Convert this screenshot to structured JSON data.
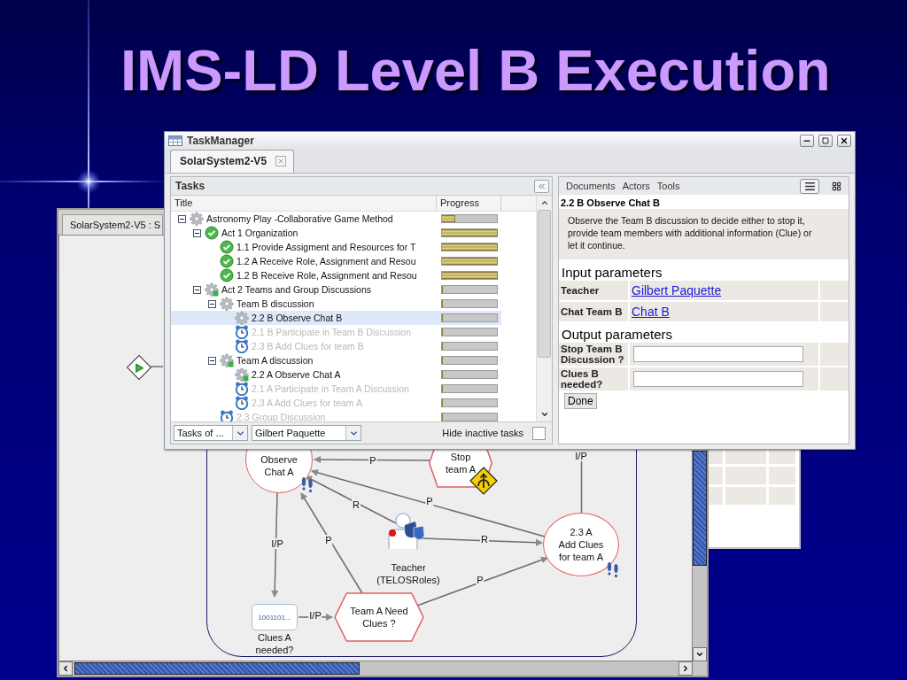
{
  "slide": {
    "title": "IMS-LD Level B Execution"
  },
  "editor_window": {
    "tab": "SolarSystem2-V5 : S",
    "nodes": [
      {
        "kind": "start"
      },
      {
        "kind": "activity",
        "label": "Observe\nChat A"
      },
      {
        "kind": "decision",
        "label": "Stop\nteam A"
      },
      {
        "kind": "activity",
        "label": "2.3 A\nAdd Clues\nfor team A"
      },
      {
        "kind": "role",
        "label": "Teacher\n(TELOSRoles)"
      },
      {
        "kind": "resource",
        "content": "1001101...",
        "label": "Clues A\nneeded?"
      },
      {
        "kind": "decision",
        "label": "Team A Need\nClues ?"
      }
    ],
    "edges": [
      {
        "kind": "line"
      },
      {
        "kind": "arrow",
        "label": "P"
      },
      {
        "kind": "arrow",
        "label": "P"
      },
      {
        "kind": "arrow",
        "label": "R"
      },
      {
        "kind": "arrow",
        "label": "R"
      },
      {
        "kind": "arrow",
        "label": "I/P"
      },
      {
        "kind": "arrow",
        "label": "P"
      },
      {
        "kind": "arrow",
        "label": "P"
      },
      {
        "kind": "arrow",
        "label": "I/P"
      },
      {
        "kind": "line",
        "label": "I/P"
      }
    ]
  },
  "task_window": {
    "title": "TaskManager",
    "tabs": [
      {
        "label": "SolarSystem2-V5",
        "selected": true
      }
    ],
    "tasks_panel": {
      "title": "Tasks",
      "columns": [
        "Title",
        "Progress"
      ],
      "tree": [
        {
          "label": "Astronomy Play -Collaborative Game Method",
          "kind": "running",
          "inactive": false,
          "selected": false,
          "expanded": true,
          "level": 0.24,
          "children": [
            {
              "label": "Act 1 Organization",
              "kind": "done",
              "inactive": false,
              "selected": false,
              "expanded": true,
              "level": 1,
              "children": [
                {
                  "label": "1.1 Provide Assigment and Resources for T",
                  "kind": "done",
                  "inactive": false,
                  "selected": false,
                  "level": 1
                },
                {
                  "label": "1.2 A Receive Role, Assignment and Resou",
                  "kind": "done",
                  "inactive": false,
                  "selected": false,
                  "level": 1
                },
                {
                  "label": "1.2 B Receive Role, Assignment and Resou",
                  "kind": "done",
                  "inactive": false,
                  "selected": false,
                  "level": 1
                }
              ]
            },
            {
              "label": "Act 2 Teams and Group Discussions",
              "kind": "started",
              "inactive": false,
              "selected": false,
              "expanded": true,
              "level": 0,
              "children": [
                {
                  "label": "Team B discussion",
                  "kind": "running",
                  "inactive": false,
                  "selected": false,
                  "expanded": true,
                  "level": 0,
                  "children": [
                    {
                      "label": "2.2 B Observe Chat B",
                      "kind": "running",
                      "inactive": false,
                      "selected": true,
                      "level": 0
                    },
                    {
                      "label": "2.1 B Participate in Team B Discussion",
                      "kind": "waiting",
                      "inactive": true,
                      "selected": false,
                      "level": 0
                    },
                    {
                      "label": "2.3 B Add Clues for team B",
                      "kind": "waiting",
                      "inactive": true,
                      "selected": false,
                      "level": 0
                    }
                  ]
                },
                {
                  "label": "Team A discussion",
                  "kind": "started",
                  "inactive": false,
                  "selected": false,
                  "expanded": true,
                  "level": 0,
                  "children": [
                    {
                      "label": "2.2 A Observe Chat A",
                      "kind": "started",
                      "inactive": false,
                      "selected": false,
                      "level": 0
                    },
                    {
                      "label": "2.1 A Participate in Team A Discussion",
                      "kind": "waiting",
                      "inactive": true,
                      "selected": false,
                      "level": 0
                    },
                    {
                      "label": "2.3 A Add Clues for team A",
                      "kind": "waiting",
                      "inactive": true,
                      "selected": false,
                      "level": 0
                    }
                  ]
                },
                {
                  "label": "2.3 Group Discussion",
                  "kind": "waiting",
                  "inactive": true,
                  "selected": false,
                  "level": 0
                }
              ]
            }
          ]
        }
      ],
      "filters": [
        {
          "value": "Tasks of ..."
        },
        {
          "value": "Gilbert Paquette"
        }
      ],
      "hide_inactive": {
        "label": "Hide inactive tasks",
        "checked": false
      }
    },
    "detail_panel": {
      "menu": [
        "Documents",
        "Actors",
        "Tools"
      ],
      "views": [
        {
          "kind": "list",
          "selected": true
        },
        {
          "kind": "grid",
          "selected": false
        }
      ],
      "task_title": "2.2 B Observe Chat B",
      "description": "Observe the Team B discussion to decide either to stop it, provide team members with additional information (Clue) or let it continue.",
      "input_heading": "Input parameters",
      "inputs": [
        {
          "name": "Teacher",
          "value": "Gilbert Paquette"
        },
        {
          "name": "Chat Team B",
          "value": "Chat B"
        }
      ],
      "output_heading": "Output parameters",
      "outputs": [
        {
          "name": "Stop Team B Discussion ?"
        },
        {
          "name": "Clues B needed?"
        }
      ],
      "button": "Done"
    }
  }
}
